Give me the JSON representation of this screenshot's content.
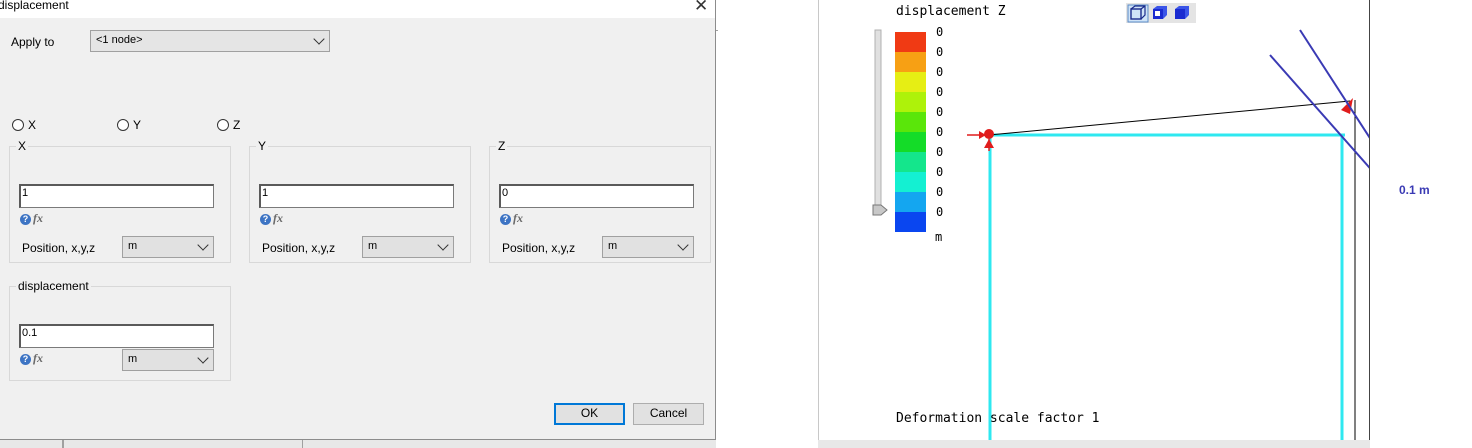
{
  "dialog": {
    "title": "displacement",
    "close_glyph": "✕",
    "apply_to_label": "Apply to",
    "apply_to_value": "<1 node>",
    "radio_x": "X",
    "radio_y": "Y",
    "radio_z": "Z",
    "groups": [
      {
        "title": "X",
        "value": "1",
        "position_label": "Position, x,y,z",
        "unit": "m"
      },
      {
        "title": "Y",
        "value": "1",
        "position_label": "Position, x,y,z",
        "unit": "m"
      },
      {
        "title": "Z",
        "value": "0",
        "position_label": "Position, x,y,z",
        "unit": "m"
      }
    ],
    "displacement_group": {
      "title": "displacement",
      "value": "0.1",
      "unit": "m"
    },
    "help_glyph": "?",
    "fx_glyph": "fx",
    "ok_label": "OK",
    "cancel_label": "Cancel"
  },
  "viewer": {
    "title": "displacement Z",
    "legend_values": [
      "0",
      "0",
      "0",
      "0",
      "0",
      "0",
      "0",
      "0",
      "0",
      "0"
    ],
    "legend_colors": [
      "#f03a14",
      "#f7a014",
      "#e6ee14",
      "#aef20a",
      "#5ae60a",
      "#14dc28",
      "#14e68c",
      "#14f0d2",
      "#14a6f0",
      "#0a46f0"
    ],
    "legend_unit": "m",
    "dimension_label": "0.1 m",
    "footer": "Deformation scale factor 1",
    "colors": {
      "structure": "#2ee8f0",
      "dimension": "#3a3ab4",
      "constraint": "#e01c1c"
    }
  }
}
